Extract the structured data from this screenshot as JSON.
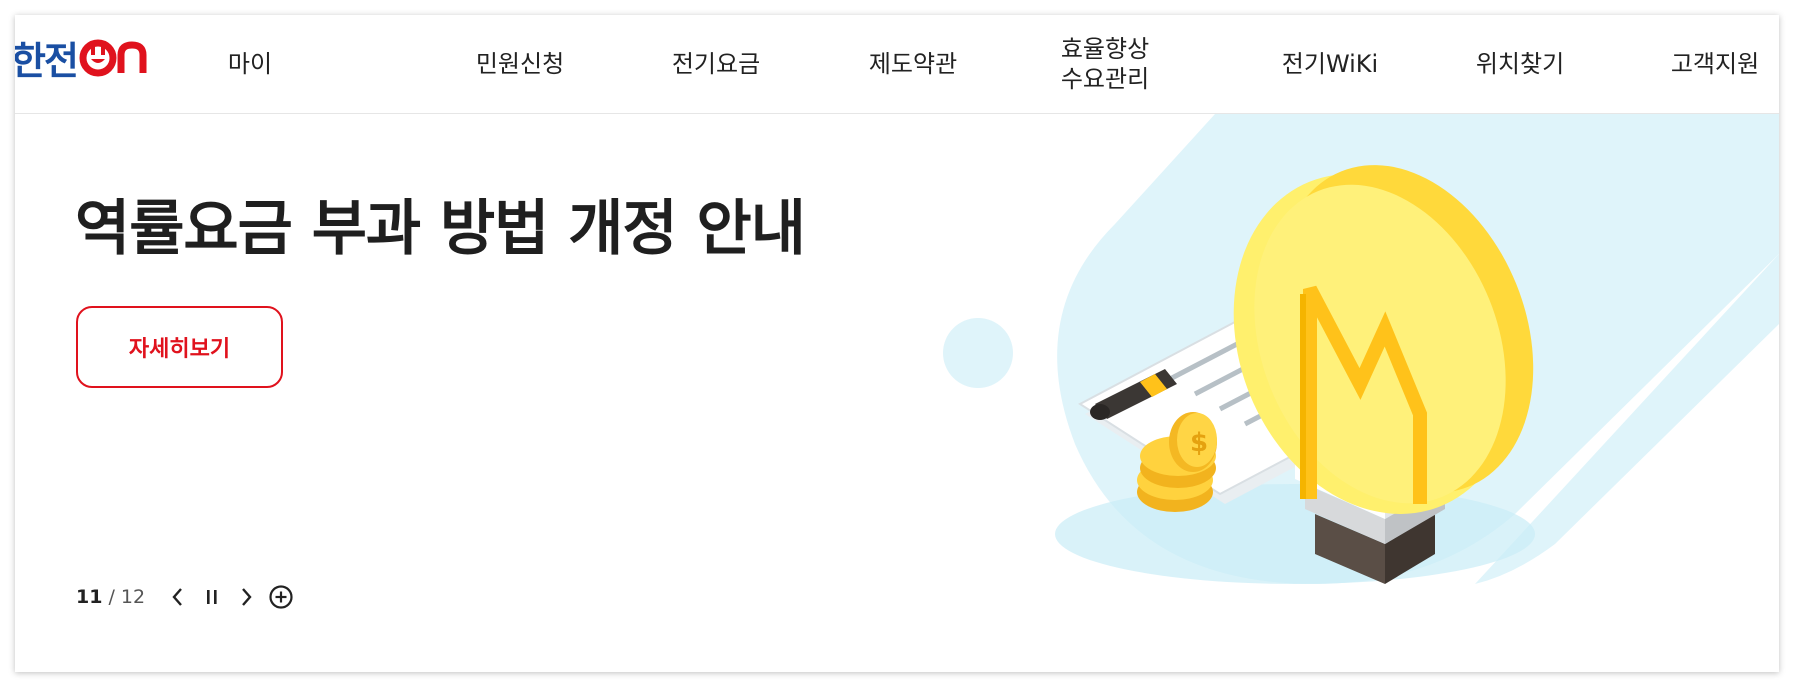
{
  "header": {
    "logo_text": "한전",
    "logo_accent": "on",
    "nav": [
      {
        "label": "마이"
      },
      {
        "label": "민원신청"
      },
      {
        "label": "전기요금"
      },
      {
        "label": "제도약관"
      },
      {
        "label_line1": "효율향상",
        "label_line2": "수요관리"
      },
      {
        "label": "전기WiKi"
      },
      {
        "label": "위치찾기"
      },
      {
        "label": "고객지원"
      }
    ]
  },
  "banner": {
    "headline": "역률요금 부과 방법 개정 안내",
    "detail_button": "자세히보기",
    "pager": {
      "current": "11",
      "separator": "/",
      "total": "12"
    }
  },
  "colors": {
    "brand_blue": "#1a4fa3",
    "brand_red": "#e0121d",
    "illustration_sky": "#dff4fa",
    "bulb_yellow": "#ffd93b"
  },
  "icons": [
    "power-plug-icon",
    "prev-arrow-icon",
    "pause-icon",
    "next-arrow-icon",
    "plus-circle-icon"
  ]
}
